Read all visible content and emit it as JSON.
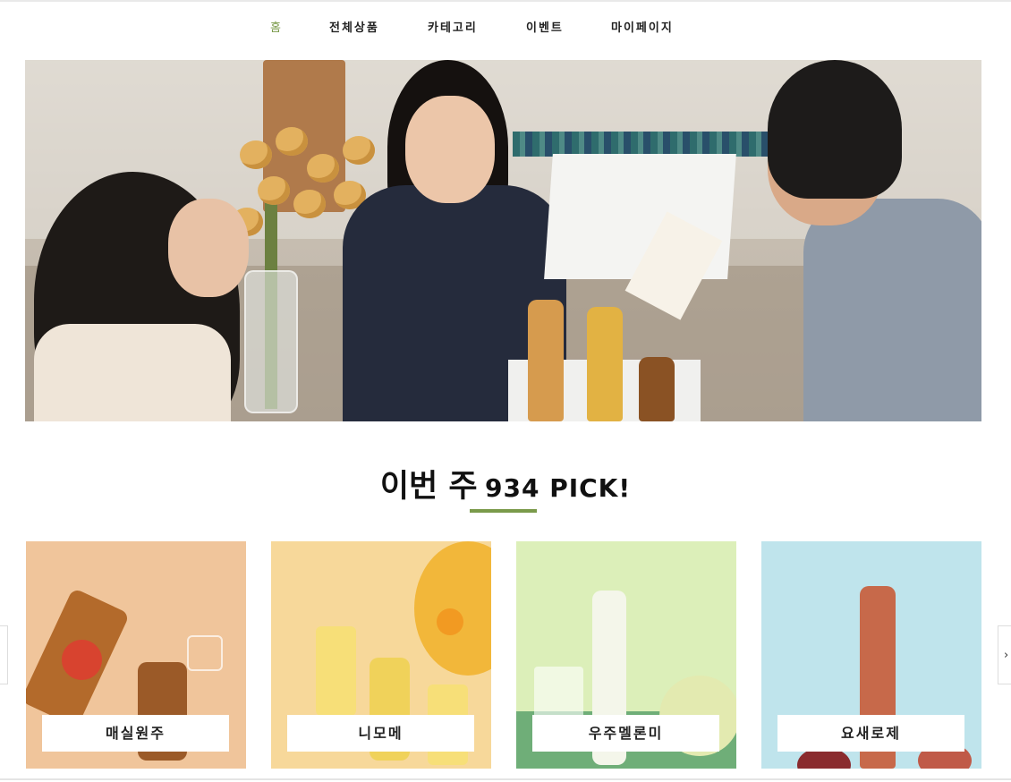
{
  "nav": {
    "items": [
      {
        "label": "홈",
        "active": true
      },
      {
        "label": "전체상품",
        "active": false
      },
      {
        "label": "카테고리",
        "active": false
      },
      {
        "label": "이벤트",
        "active": false
      },
      {
        "label": "마이페이지",
        "active": false
      }
    ]
  },
  "section": {
    "title_ko": "이번 주",
    "title_en": "934 PICK!"
  },
  "products": [
    {
      "name": "매실원주",
      "bg": "#f0c59b"
    },
    {
      "name": "니모메",
      "bg": "#f7d89a"
    },
    {
      "name": "우주멜론미",
      "bg": "#dcefb9"
    },
    {
      "name": "요새로제",
      "bg": "#bfe4ec"
    }
  ],
  "carousel": {
    "next_arrow": "›"
  },
  "colors": {
    "accent": "#7a9a4a",
    "text": "#111111"
  },
  "icons": {
    "next": "chevron-right-icon",
    "prev": "chevron-left-icon"
  }
}
